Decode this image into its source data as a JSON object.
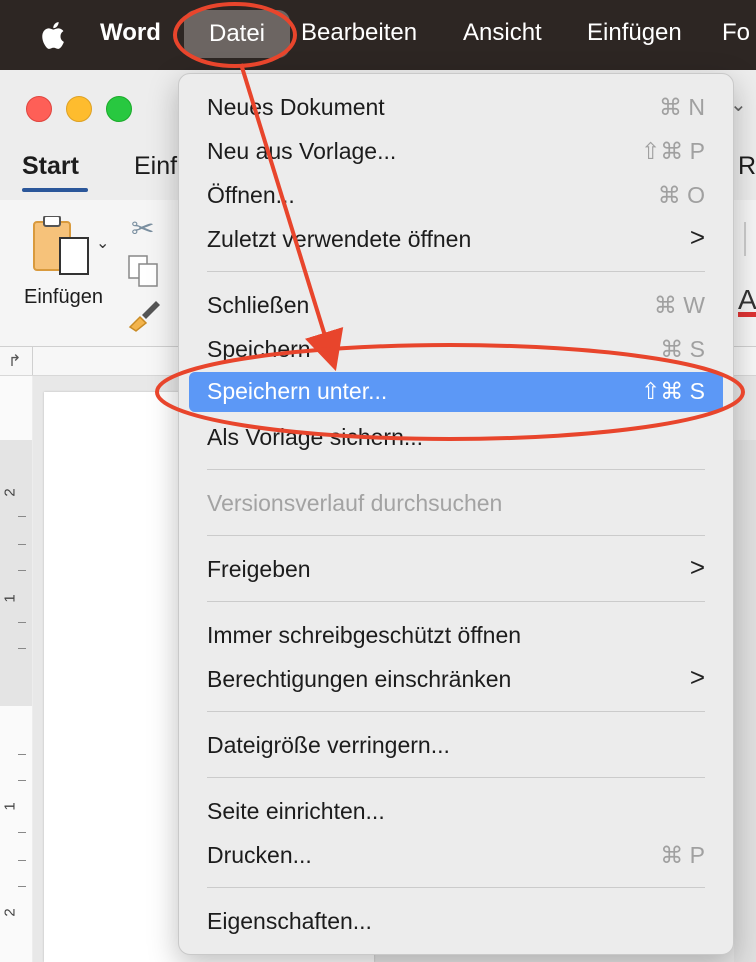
{
  "menubar": {
    "app": "Word",
    "items": [
      "Datei",
      "Bearbeiten",
      "Ansicht",
      "Einfügen",
      "Fo"
    ]
  },
  "ribbon": {
    "tabs": [
      "Start",
      "Einf",
      "R"
    ],
    "paste_label": "Einfügen",
    "right_glyph": "A"
  },
  "ruler": {
    "left_numbers": [
      "2",
      "1",
      "1",
      "2"
    ]
  },
  "menu": {
    "items": [
      {
        "label": "Neues Dokument",
        "shortcut": "⌘ N"
      },
      {
        "label": "Neu aus Vorlage...",
        "shortcut": "⇧⌘ P"
      },
      {
        "label": "Öffnen...",
        "shortcut": "⌘ O"
      },
      {
        "label": "Zuletzt verwendete öffnen",
        "submenu": ">"
      },
      {
        "label": "Schließen",
        "shortcut": "⌘ W"
      },
      {
        "label": "Speichern",
        "shortcut": "⌘ S"
      },
      {
        "label": "Speichern unter...",
        "shortcut": "⇧⌘ S",
        "highlighted": true
      },
      {
        "label": "Als Vorlage sichern..."
      },
      {
        "label": "Versionsverlauf durchsuchen",
        "disabled": true
      },
      {
        "label": "Freigeben",
        "submenu": ">"
      },
      {
        "label": "Immer schreibgeschützt öffnen"
      },
      {
        "label": "Berechtigungen einschränken",
        "submenu": ">"
      },
      {
        "label": "Dateigröße verringern..."
      },
      {
        "label": "Seite einrichten..."
      },
      {
        "label": "Drucken...",
        "shortcut": "⌘ P"
      },
      {
        "label": "Eigenschaften..."
      }
    ]
  },
  "colors": {
    "highlight": "#5c98f6",
    "annotation": "#e8452c"
  }
}
